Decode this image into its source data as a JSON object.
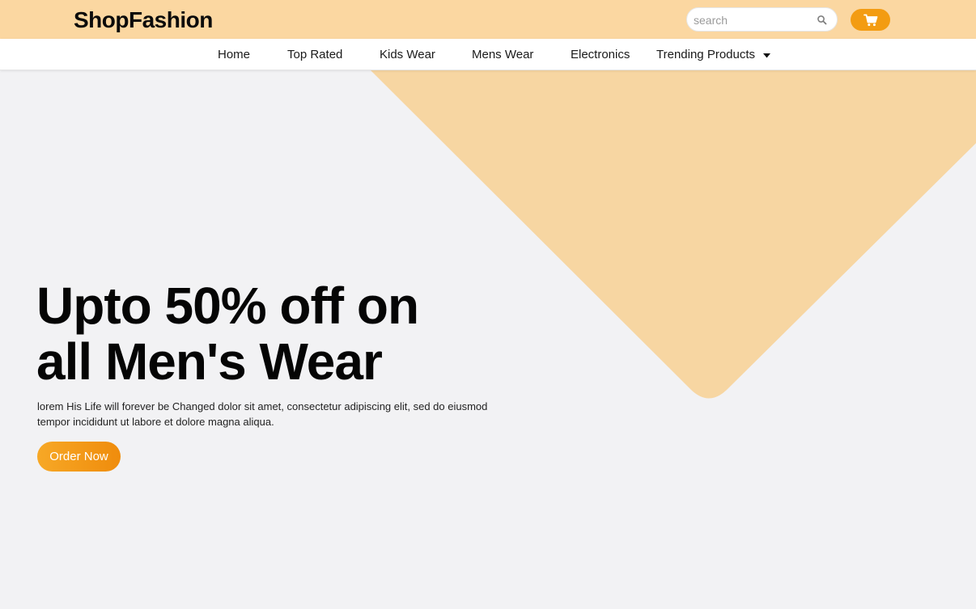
{
  "header": {
    "brand": "ShopFashion",
    "search": {
      "placeholder": "search",
      "value": ""
    },
    "icons": {
      "search": "search-icon",
      "cart": "cart-icon"
    }
  },
  "nav": {
    "items": [
      {
        "label": "Home"
      },
      {
        "label": "Top Rated"
      },
      {
        "label": "Kids Wear"
      },
      {
        "label": "Mens Wear"
      },
      {
        "label": "Electronics"
      },
      {
        "label": "Trending Products",
        "dropdown": true
      }
    ]
  },
  "hero": {
    "headline_line1": "Upto 50% off on",
    "headline_line2": "all Men's Wear",
    "description": "lorem His Life will forever be Changed dolor sit amet, consectetur adipiscing elit, sed do eiusmod tempor incididunt ut labore et dolore magna aliqua.",
    "cta_label": "Order Now"
  },
  "colors": {
    "header_bg": "#fbd7a1",
    "accent": "#f39c12",
    "hero_shape": "#f7d6a2",
    "page_bg": "#f2f2f4"
  }
}
